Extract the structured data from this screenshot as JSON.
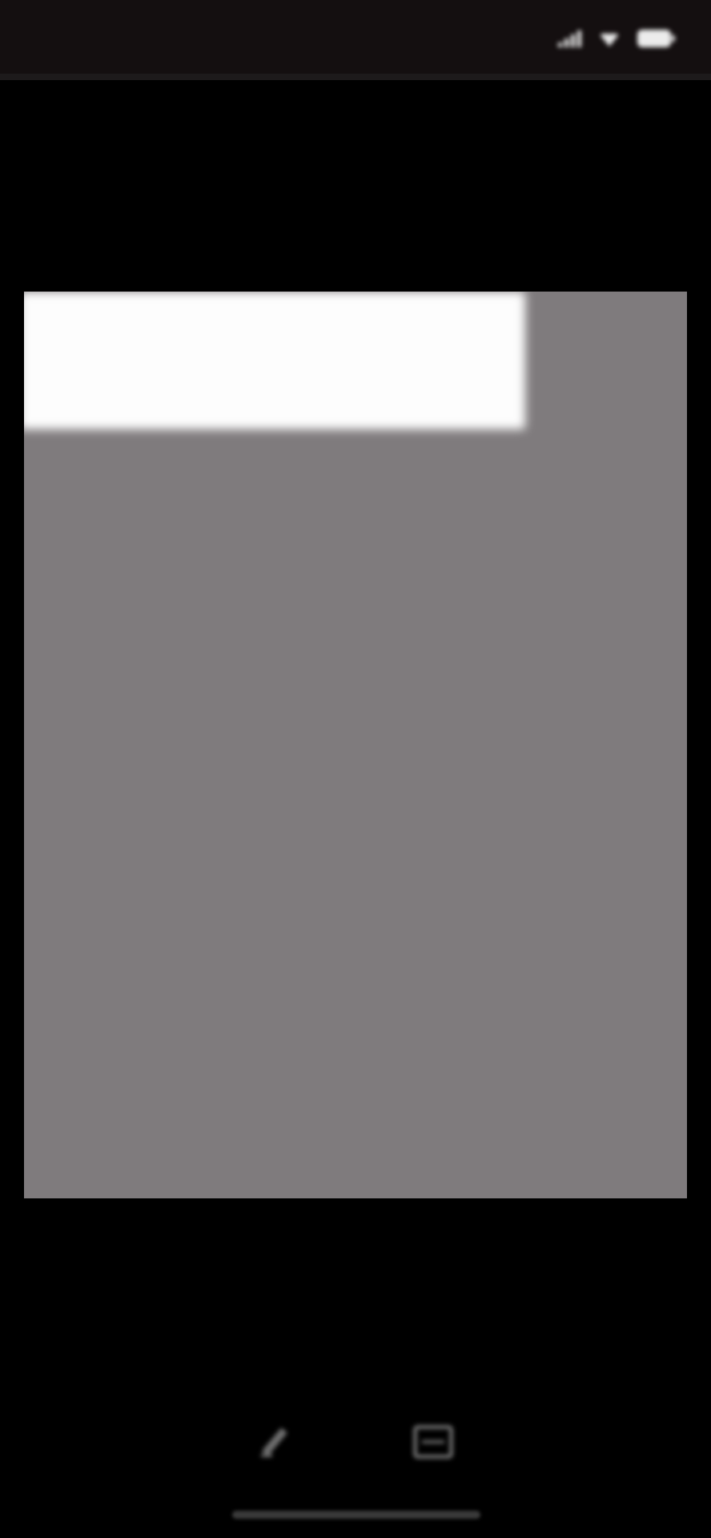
{
  "status_bar": {
    "title": "",
    "icons": [
      "signal-icon",
      "wifi-icon",
      "battery-icon"
    ]
  },
  "document": {
    "background_color": "#7f7b7d",
    "lines": [
      {
        "text": "",
        "kind": "heading"
      },
      {
        "text": "",
        "kind": "heading"
      },
      {
        "text": "",
        "kind": "sub"
      },
      {
        "text": "",
        "kind": "sub"
      },
      {
        "text": "",
        "kind": "sub"
      },
      {
        "text": "",
        "kind": "heading"
      },
      {
        "text": "",
        "kind": "sub"
      },
      {
        "text": "",
        "kind": "sub"
      },
      {
        "text": "",
        "kind": "sub"
      },
      {
        "text": "",
        "kind": "heading"
      },
      {
        "text": "",
        "kind": "sub"
      },
      {
        "text": "",
        "kind": "sub"
      },
      {
        "text": "",
        "kind": "sub"
      },
      {
        "text": "",
        "kind": "heading"
      },
      {
        "text": "",
        "kind": "sub"
      },
      {
        "text": "",
        "kind": "sub"
      },
      {
        "text": "",
        "kind": "sub"
      },
      {
        "text": "",
        "kind": "heading"
      },
      {
        "text": "",
        "kind": "sub"
      },
      {
        "text": "",
        "kind": "sub"
      },
      {
        "text": "",
        "kind": "sub"
      },
      {
        "text": "",
        "kind": "heading"
      },
      {
        "text": "",
        "kind": "sub"
      },
      {
        "text": "",
        "kind": "sub"
      },
      {
        "text": "",
        "kind": "sub"
      },
      {
        "text": "",
        "kind": "heading"
      },
      {
        "text": "",
        "kind": "sub"
      },
      {
        "text": "",
        "kind": "sub"
      },
      {
        "text": "",
        "kind": "sub"
      },
      {
        "text": "",
        "kind": "heading"
      },
      {
        "text": "",
        "kind": "sub"
      },
      {
        "text": "",
        "kind": "sub"
      },
      {
        "text": "",
        "kind": "sub"
      },
      {
        "text": "",
        "kind": "heading"
      },
      {
        "text": "",
        "kind": "sub"
      },
      {
        "text": "",
        "kind": "sub"
      },
      {
        "text": "",
        "kind": "sub"
      },
      {
        "text": "",
        "kind": "heading"
      },
      {
        "text": "",
        "kind": "heading"
      },
      {
        "text": "",
        "kind": "heading"
      },
      {
        "text": "",
        "kind": "heading"
      }
    ]
  },
  "toolbar": {
    "left_label": "",
    "right_label": "",
    "icons": [
      "edit-icon",
      "scan-icon"
    ]
  }
}
